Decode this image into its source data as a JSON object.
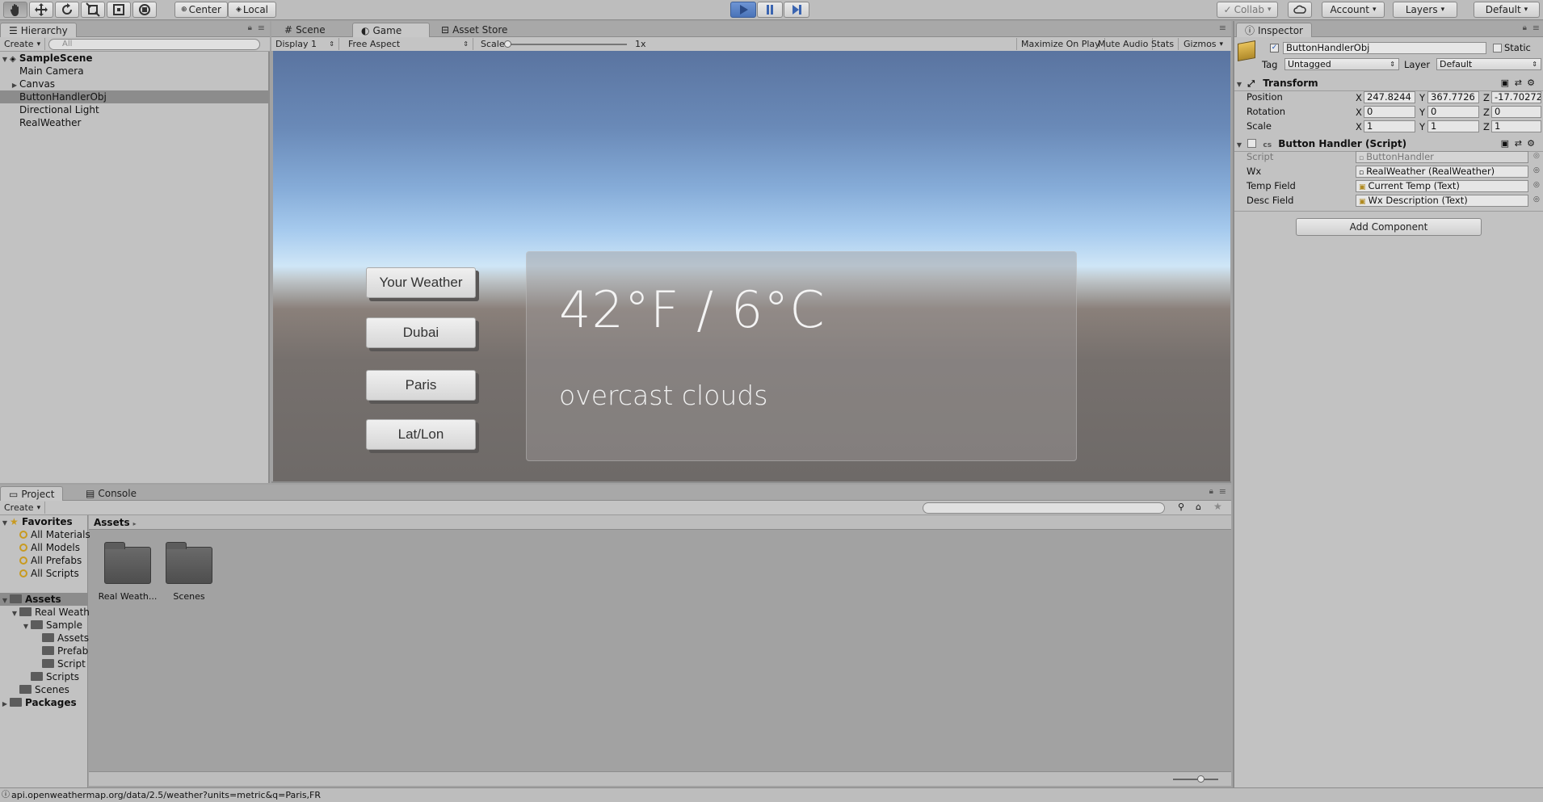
{
  "toolbar": {
    "center_label": "Center",
    "local_label": "Local",
    "collab_label": "Collab",
    "account_label": "Account",
    "layers_label": "Layers",
    "layout_label": "Default"
  },
  "hierarchy": {
    "tab_label": "Hierarchy",
    "create_label": "Create",
    "search_placeholder": "All",
    "scene_name": "SampleScene",
    "items": [
      {
        "label": "Main Camera"
      },
      {
        "label": "Canvas"
      },
      {
        "label": "ButtonHandlerObj"
      },
      {
        "label": "Directional Light"
      },
      {
        "label": "RealWeather"
      }
    ]
  },
  "center_tabs": {
    "scene": "Scene",
    "game": "Game",
    "asset_store": "Asset Store"
  },
  "game_toolbar": {
    "display": "Display 1",
    "aspect": "Free Aspect",
    "scale_label": "Scale",
    "scale_value": "1x",
    "maximize": "Maximize On Play",
    "mute": "Mute Audio",
    "stats": "Stats",
    "gizmos": "Gizmos"
  },
  "game": {
    "buttons": [
      "Your Weather",
      "Dubai",
      "Paris",
      "Lat/Lon"
    ],
    "temperature": "42°F / 6°C",
    "description": "overcast clouds"
  },
  "inspector": {
    "tab_label": "Inspector",
    "object_name": "ButtonHandlerObj",
    "static_label": "Static",
    "tag_label": "Tag",
    "tag_value": "Untagged",
    "layer_label": "Layer",
    "layer_value": "Default",
    "transform": {
      "title": "Transform",
      "position_label": "Position",
      "rotation_label": "Rotation",
      "scale_label": "Scale",
      "position": {
        "x": "247.8244",
        "y": "367.7726",
        "z": "-17.70272"
      },
      "rotation": {
        "x": "0",
        "y": "0",
        "z": "0"
      },
      "scale": {
        "x": "1",
        "y": "1",
        "z": "1"
      }
    },
    "script_component": {
      "title": "Button Handler (Script)",
      "script_label": "Script",
      "script_value": "ButtonHandler",
      "wx_label": "Wx",
      "wx_value": "RealWeather (RealWeather)",
      "temp_label": "Temp Field",
      "temp_value": "Current Temp (Text)",
      "desc_label": "Desc Field",
      "desc_value": "Wx Description (Text)"
    },
    "add_component": "Add Component"
  },
  "project": {
    "tab_label": "Project",
    "console_tab": "Console",
    "create_label": "Create",
    "favorites": "Favorites",
    "favorite_items": [
      "All Materials",
      "All Models",
      "All Prefabs",
      "All Scripts"
    ],
    "assets_root": "Assets",
    "tree": [
      {
        "label": "Real Weath"
      },
      {
        "label": "Sample"
      },
      {
        "label": "Assets"
      },
      {
        "label": "Prefab"
      },
      {
        "label": "Script"
      },
      {
        "label": "Scripts"
      },
      {
        "label": "Scenes"
      }
    ],
    "packages": "Packages",
    "breadcrumb": "Assets",
    "folders": [
      {
        "label": "Real Weath..."
      },
      {
        "label": "Scenes"
      }
    ]
  },
  "status_bar": {
    "message": "api.openweathermap.org/data/2.5/weather?units=metric&q=Paris,FR"
  },
  "colors": {
    "editor_bg": "#a2a2a2",
    "play_active": "#4a73b8",
    "selection": "#8c8c8c"
  }
}
